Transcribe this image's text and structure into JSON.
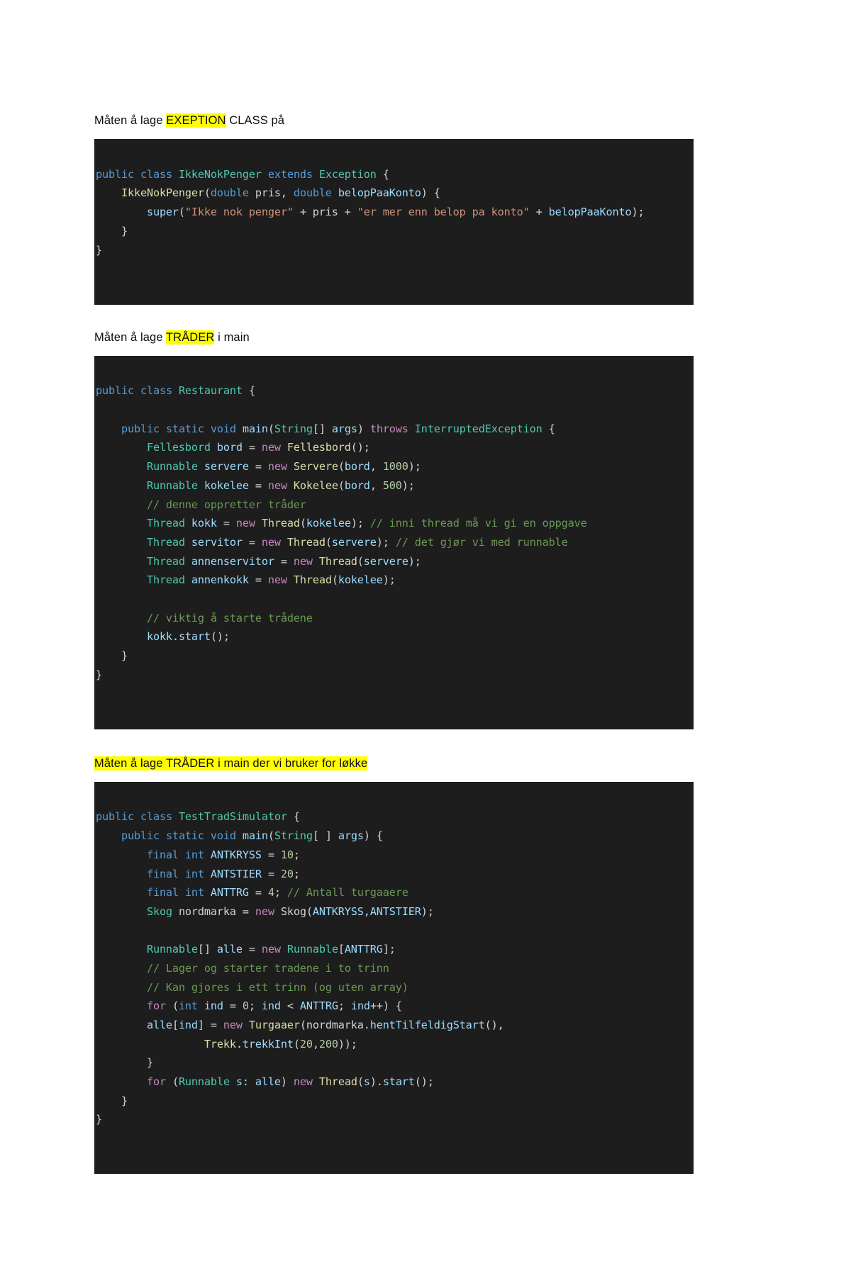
{
  "document": {
    "background_color": "#ffffff",
    "text_color": "#0d0d0d",
    "highlight_color": "#ffff00",
    "code_background": "#1e1d1d",
    "code_text_color": "#d4d4d4"
  },
  "sections": [
    {
      "heading": {
        "before": "Måten å lage ",
        "highlight": "EXEPTION",
        "after": " CLASS på",
        "fully_highlighted": false
      },
      "code": {
        "language": "java",
        "lines": [
          "public class IkkeNokPenger extends Exception {",
          "    IkkeNokPenger(double pris, double belopPaaKonto) {",
          "        super(\"Ikke nok penger\" + pris + \"er mer enn belop pa konto\" + belopPaaKonto);",
          "    }",
          "}"
        ]
      }
    },
    {
      "heading": {
        "before": "Måten å lage ",
        "highlight": "TRÅDER",
        "after": " i main",
        "fully_highlighted": false
      },
      "code": {
        "language": "java",
        "lines": [
          "public class Restaurant {",
          "",
          "    public static void main(String[] args) throws InterruptedException {",
          "        Fellesbord bord = new Fellesbord();",
          "        Runnable servere = new Servere(bord, 1000);",
          "        Runnable kokelee = new Kokelee(bord, 500);",
          "        // denne oppretter tråder",
          "        Thread kokk = new Thread(kokelee); // inni thread må vi gi en oppgave",
          "        Thread servitor = new Thread(servere); // det gjør vi med runnable",
          "        Thread annenservitor = new Thread(servere);",
          "        Thread annenkokk = new Thread(kokelee);",
          "",
          "        // viktig å starte trådene",
          "        kokk.start();",
          "    }",
          "}"
        ]
      }
    },
    {
      "heading": {
        "before": "",
        "highlight": "Måten å lage TRÅDER i main der vi bruker for løkke",
        "after": "",
        "fully_highlighted": true
      },
      "code": {
        "language": "java",
        "lines": [
          "public class TestTradSimulator {",
          "    public static void main(String[ ] args) {",
          "        final int ANTKRYSS = 10;",
          "        final int ANTSTIER = 20;",
          "        final int ANTTRG = 4; // Antall turgaaere",
          "        Skog nordmarka = new Skog(ANTKRYSS,ANTSTIER);",
          "",
          "        Runnable[] alle = new Runnable[ANTTRG];",
          "        // Lager og starter tradene i to trinn",
          "        // Kan gjores i ett trinn (og uten array)",
          "        for (int ind = 0; ind < ANTTRG; ind++) {",
          "        alle[ind] = new Turgaaer(nordmarka.hentTilfeldigStart(),",
          "                 Trekk.trekkInt(20,200));",
          "        }",
          "        for (Runnable s: alle) new Thread(s).start();",
          "    }",
          "}"
        ]
      }
    }
  ],
  "syntax_colors": {
    "keyword": "#569cd6",
    "type": "#4ec9b0",
    "function": "#dcdcaa",
    "string": "#ce9178",
    "comment": "#6a9955",
    "operator_new": "#c586c0",
    "number": "#b5cea8",
    "variable": "#9cdcfe",
    "plain": "#d4d4d4"
  }
}
